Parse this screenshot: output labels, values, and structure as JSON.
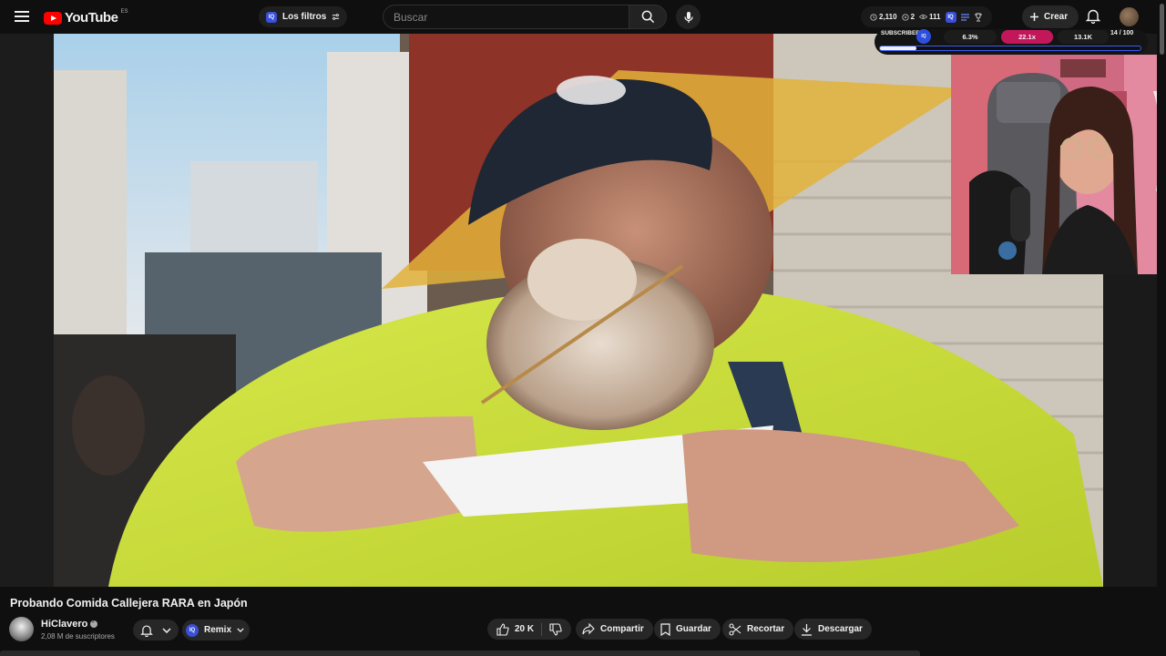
{
  "header": {
    "logo_text": "YouTube",
    "region": "ES",
    "filters_badge": "IQ",
    "filters_label": "Los filtros",
    "search_placeholder": "Buscar",
    "stats": {
      "watch": "2,110",
      "views2": "2",
      "eye": "111"
    },
    "ext_badge": "IQ",
    "create_label": "Crear"
  },
  "video": {
    "title": "Probando Comida Callejera RARA en Japón",
    "channel_name": "HiClavero",
    "subscribers": "2,08 M de suscriptores"
  },
  "actions": {
    "remix_badge": "IQ",
    "remix_label": "Remix",
    "likes": "20 K",
    "share_label": "Compartir",
    "save_label": "Guardar",
    "clip_label": "Recortar",
    "download_label": "Descargar"
  },
  "extension": {
    "subscribers_label": "SUBSCRIBERS",
    "logo": "IQ",
    "metric_1": "6.3%",
    "metric_2": "22.1x",
    "metric_3": "13.1K",
    "count": "14 / 100",
    "progress_fraction": 0.14,
    "accent_color": "#c2185b",
    "bar_border_color": "#3d5bf0"
  },
  "colors": {
    "brand_red": "#ff0000",
    "background": "#0f0f0f",
    "chip": "#272727"
  },
  "icons": [
    "menu-icon",
    "youtube-logo-icon",
    "filter-icon",
    "search-icon",
    "microphone-icon",
    "clock-icon",
    "eye-icon",
    "trophy-icon",
    "plus-icon",
    "bell-icon",
    "verified-icon",
    "chevron-down-icon",
    "thumbs-up-icon",
    "thumbs-down-icon",
    "share-icon",
    "bookmark-icon",
    "scissors-icon",
    "download-icon"
  ]
}
